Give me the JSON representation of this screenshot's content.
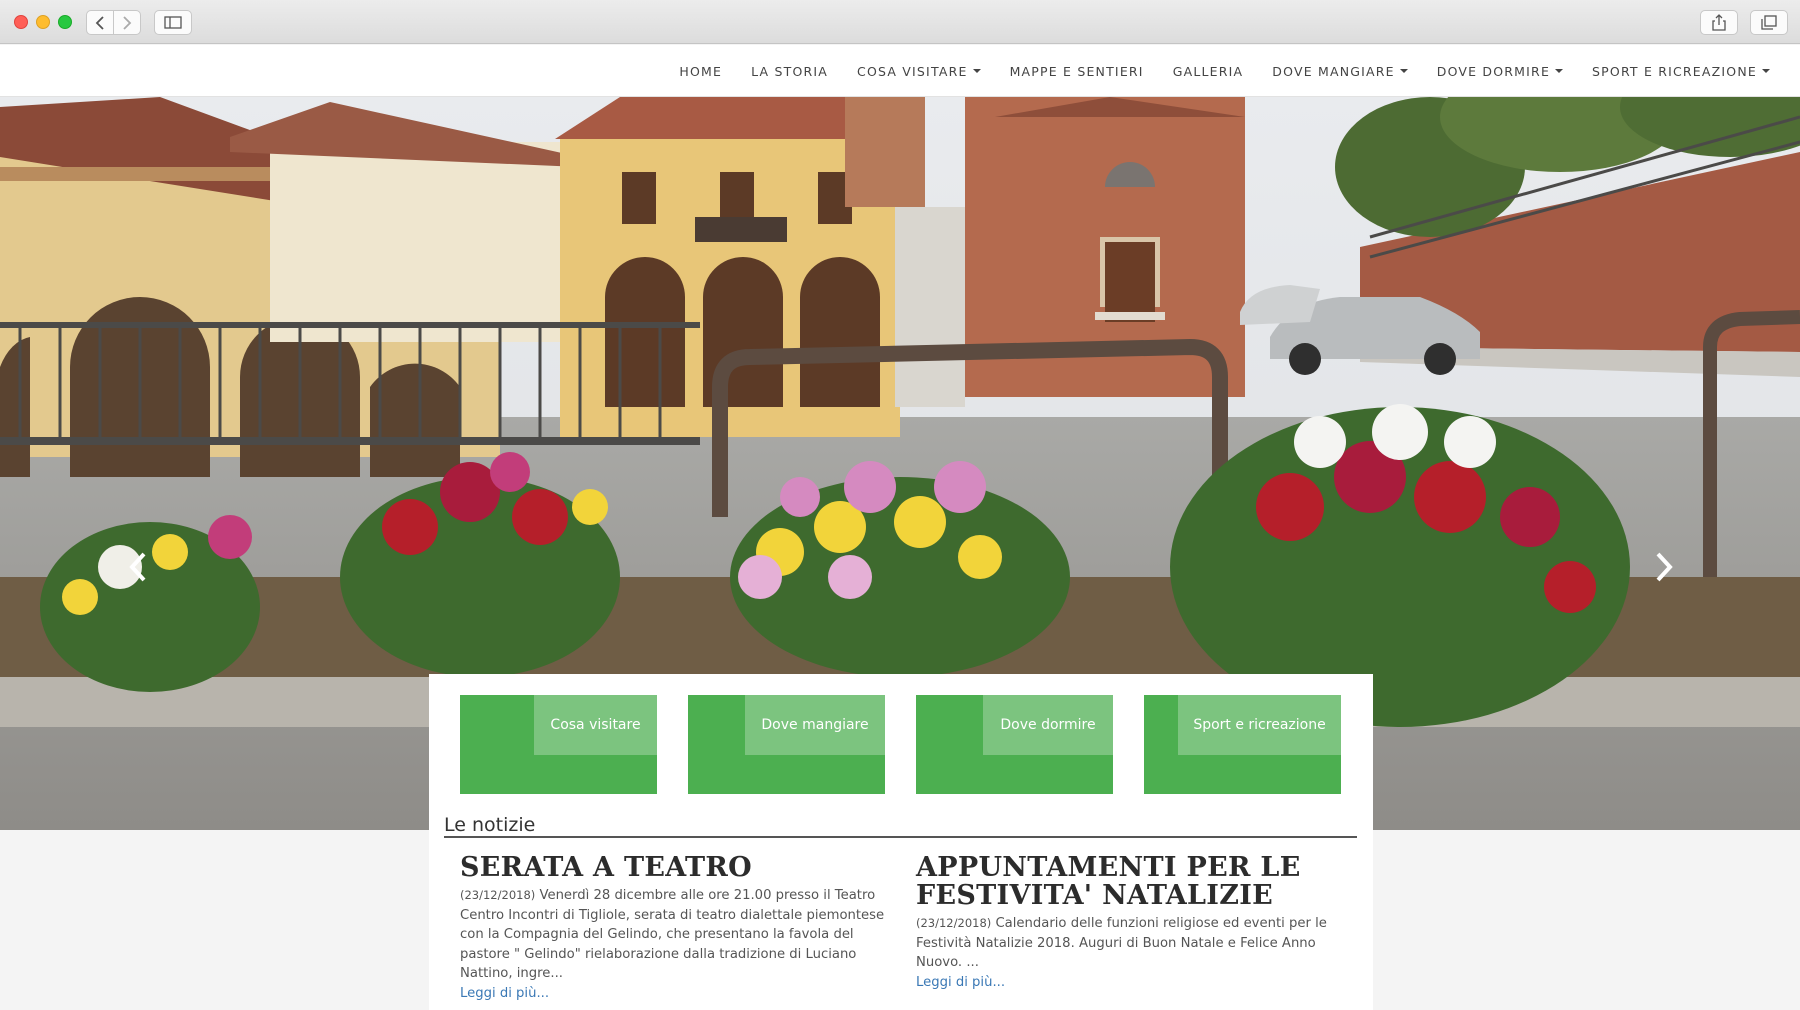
{
  "nav": {
    "items": [
      {
        "label": "HOME",
        "dropdown": false
      },
      {
        "label": "LA STORIA",
        "dropdown": false
      },
      {
        "label": "COSA VISITARE",
        "dropdown": true
      },
      {
        "label": "MAPPE E SENTIERI",
        "dropdown": false
      },
      {
        "label": "GALLERIA",
        "dropdown": false
      },
      {
        "label": "DOVE MANGIARE",
        "dropdown": true
      },
      {
        "label": "DOVE DORMIRE",
        "dropdown": true
      },
      {
        "label": "SPORT E RICREAZIONE",
        "dropdown": true
      }
    ]
  },
  "tiles": [
    {
      "label": "Cosa visitare"
    },
    {
      "label": "Dove mangiare"
    },
    {
      "label": "Dove dormire"
    },
    {
      "label": "Sport e ricreazione"
    }
  ],
  "news_section": {
    "title": "Le notizie",
    "articles": [
      {
        "title": "SERATA A TEATRO",
        "date": "(23/12/2018)",
        "body": "Venerdì 28 dicembre alle ore 21.00 presso il Teatro Centro Incontri di Tigliole, serata di teatro dialettale piemontese con la Compagnia del Gelindo, che presentano la favola del pastore \" Gelindo\" rielaborazione dalla tradizione di Luciano Nattino, ingre...",
        "more": "Leggi di più..."
      },
      {
        "title": "APPUNTAMENTI PER LE FESTIVITA' NATALIZIE",
        "date": "(23/12/2018)",
        "body": "Calendario delle funzioni religiose ed eventi per le Festività Natalizie 2018. Auguri di Buon Natale e Felice Anno Nuovo. ...",
        "more": "Leggi di più..."
      }
    ]
  },
  "colors": {
    "tile_green": "#4caf50",
    "tile_label_green": "#7cc47f",
    "link_blue": "#3a78b5"
  }
}
